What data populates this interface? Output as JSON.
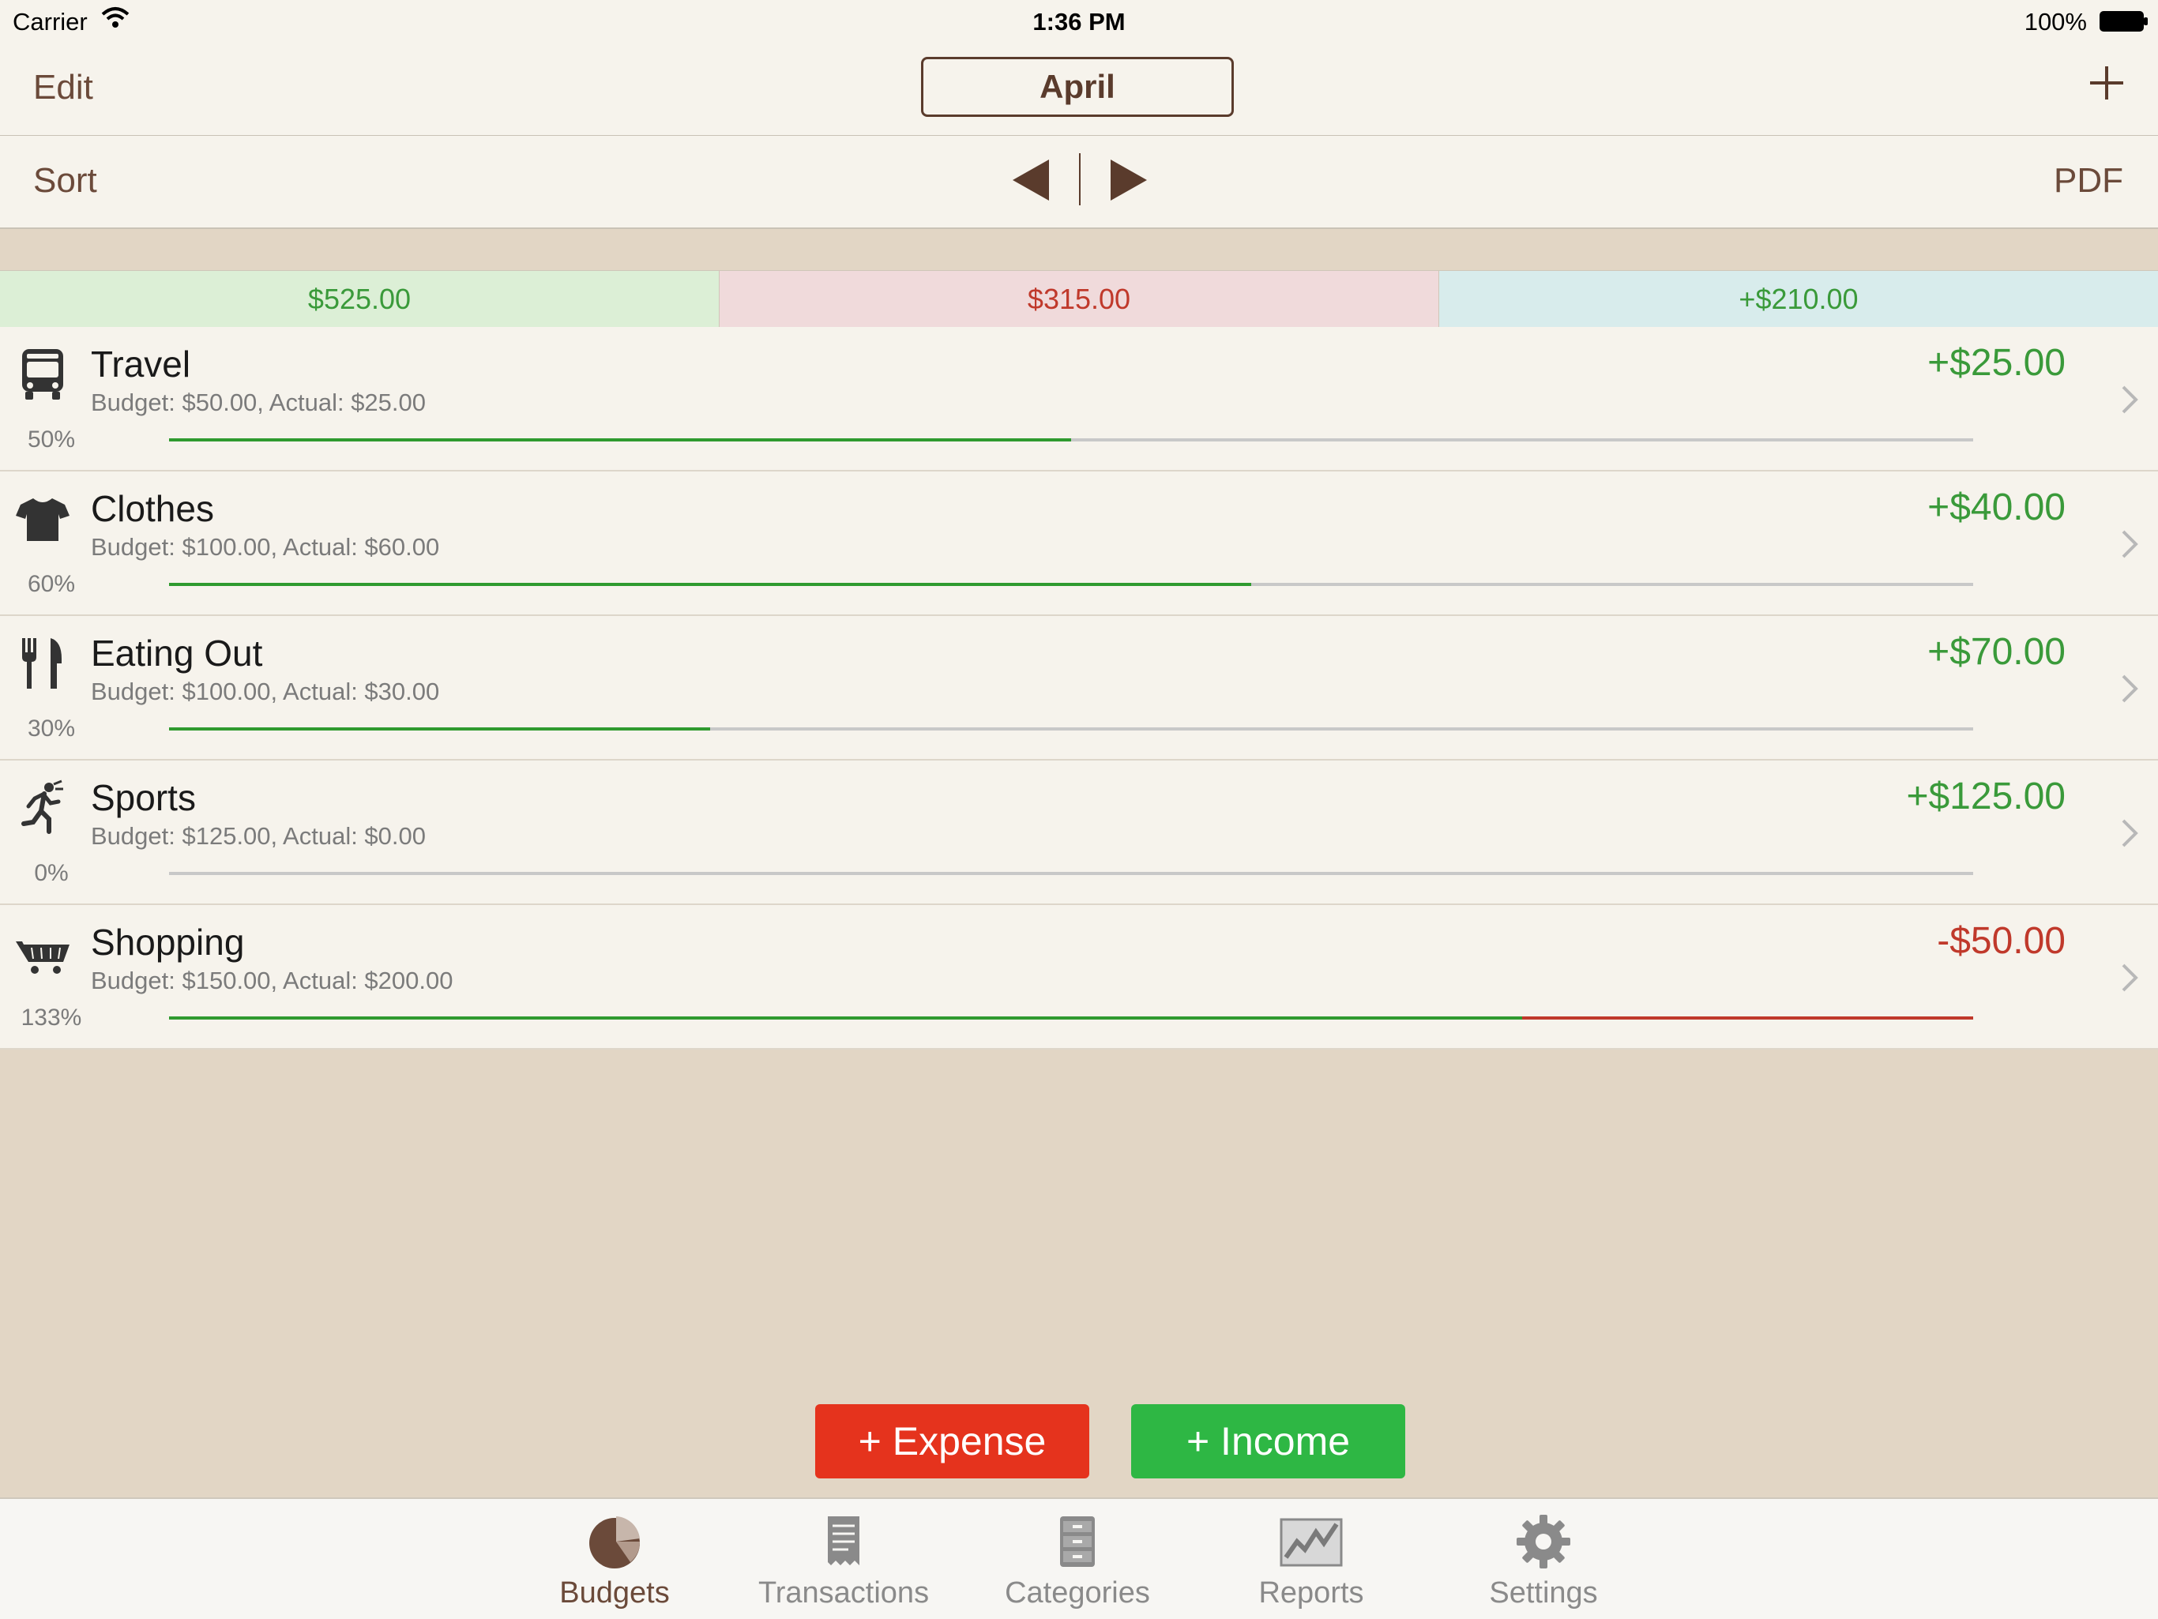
{
  "status_bar": {
    "carrier": "Carrier",
    "time": "1:36 PM",
    "battery": "100%"
  },
  "nav": {
    "edit_label": "Edit",
    "month": "April",
    "add_icon": "plus-icon"
  },
  "toolbar": {
    "sort_label": "Sort",
    "pdf_label": "PDF"
  },
  "summary": {
    "budget": "$525.00",
    "actual": "$315.00",
    "difference": "+$210.00"
  },
  "categories": [
    {
      "name": "Travel",
      "detail": "Budget: $50.00, Actual: $25.00",
      "percent_label": "50%",
      "difference": "+$25.00",
      "progress": 0.5,
      "icon": "bus-icon"
    },
    {
      "name": "Clothes",
      "detail": "Budget: $100.00, Actual: $60.00",
      "percent_label": "60%",
      "difference": "+$40.00",
      "progress": 0.6,
      "icon": "tshirt-icon"
    },
    {
      "name": "Eating Out",
      "detail": "Budget: $100.00, Actual: $30.00",
      "percent_label": "30%",
      "difference": "+$70.00",
      "progress": 0.3,
      "icon": "fork-knife-icon"
    },
    {
      "name": "Sports",
      "detail": "Budget: $125.00, Actual: $0.00",
      "percent_label": "0%",
      "difference": "+$125.00",
      "progress": 0.0,
      "icon": "runner-icon"
    },
    {
      "name": "Shopping",
      "detail": "Budget: $150.00, Actual: $200.00",
      "percent_label": "133%",
      "difference": "-$50.00",
      "progress": 1.333,
      "icon": "cart-icon"
    }
  ],
  "actions": {
    "expense_label": "+ Expense",
    "income_label": "+ Income"
  },
  "tabs": [
    {
      "label": "Budgets",
      "icon": "pie-chart-icon",
      "active": true
    },
    {
      "label": "Transactions",
      "icon": "receipt-icon",
      "active": false
    },
    {
      "label": "Categories",
      "icon": "drawers-icon",
      "active": false
    },
    {
      "label": "Reports",
      "icon": "line-chart-icon",
      "active": false
    },
    {
      "label": "Settings",
      "icon": "gear-icon",
      "active": false
    }
  ],
  "colors": {
    "positive": "#3a9a3a",
    "negative": "#c0392b",
    "expense_button": "#e5331d",
    "income_button": "#2eb744",
    "accent_brown": "#6b4a3a"
  }
}
